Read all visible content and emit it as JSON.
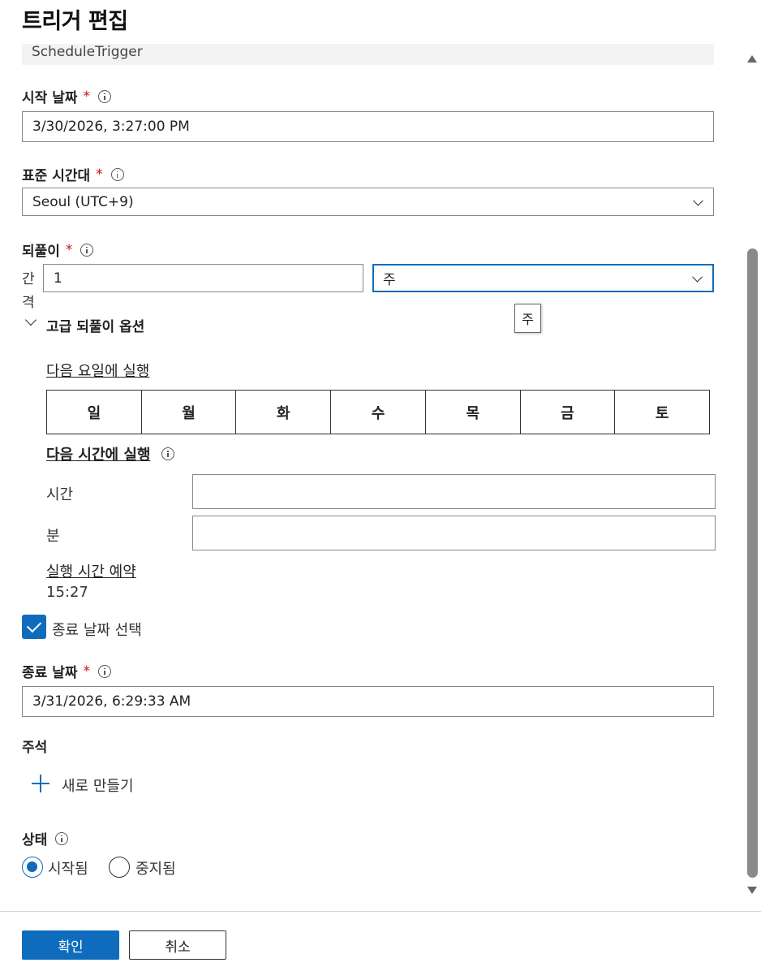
{
  "panel": {
    "title": "트리거 편집",
    "type_value": "ScheduleTrigger"
  },
  "start_date": {
    "label": "시작 날짜",
    "required_mark": "*",
    "value": "3/30/2026, 3:27:00 PM"
  },
  "timezone": {
    "label": "표준 시간대",
    "required_mark": "*",
    "value": "Seoul (UTC+9)"
  },
  "recurrence": {
    "label": "되풀이",
    "required_mark": "*",
    "interval_label_1": "간",
    "interval_label_2": "격",
    "interval_value": "1",
    "unit_value": "주",
    "tooltip": "주"
  },
  "advanced": {
    "toggle_label": "고급 되풀이 옵션",
    "weekdays_link": "다음 요일에 실행",
    "weekdays": [
      "일",
      "월",
      "화",
      "수",
      "목",
      "금",
      "토"
    ],
    "times_link": "다음 시간에 실행",
    "hours_label": "시간",
    "hours_value": "",
    "minutes_label": "분",
    "minutes_value": "",
    "schedule_link": "실행 시간 예약",
    "schedule_value": "15:27"
  },
  "end_date_toggle": {
    "label": "종료 날짜 선택",
    "checked": true
  },
  "end_date": {
    "label": "종료 날짜",
    "required_mark": "*",
    "value": "3/31/2026, 6:29:33 AM"
  },
  "annotations": {
    "label": "주석",
    "new_label": "새로 만들기"
  },
  "status": {
    "label": "상태",
    "options": [
      {
        "label": "시작됨",
        "selected": true
      },
      {
        "label": "중지됨",
        "selected": false
      }
    ]
  },
  "footer": {
    "ok_label": "확인",
    "cancel_label": "취소"
  },
  "colors": {
    "accent": "#0f6cbd",
    "required": "#c50f1f"
  }
}
